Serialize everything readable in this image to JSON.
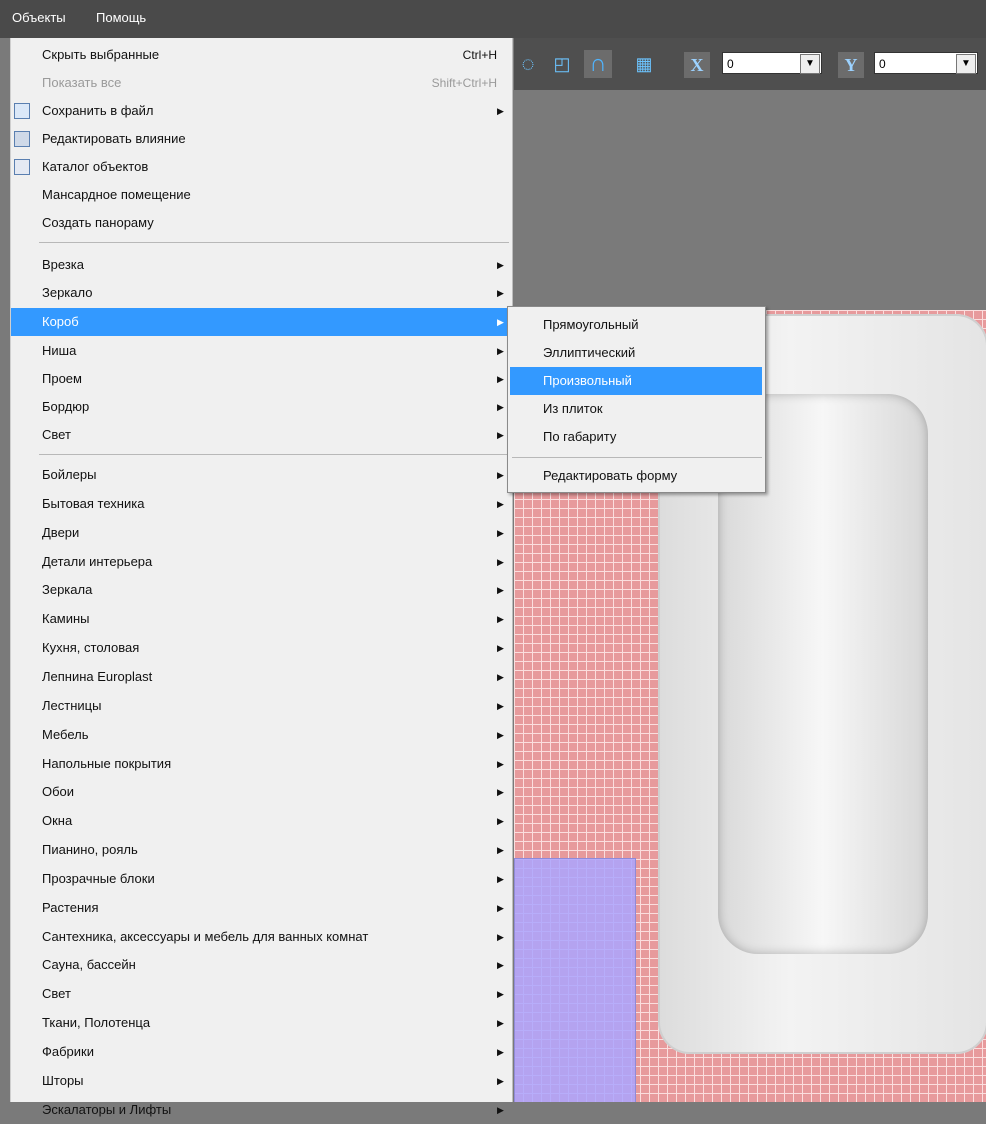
{
  "menubar": {
    "items": [
      "Объекты",
      "Помощь"
    ]
  },
  "toolbar": {
    "x_label": "X",
    "x_value": "0",
    "y_label": "Y",
    "y_value": "0"
  },
  "menu": {
    "top_items": [
      {
        "label": "Скрыть выбранные",
        "shortcut": "Ctrl+H"
      },
      {
        "label": "Показать все",
        "shortcut": "Shift+Ctrl+H",
        "disabled": true
      },
      {
        "label": "Сохранить в файл",
        "submenu": true,
        "icon": "floppy-disk-icon"
      },
      {
        "label": "Редактировать влияние",
        "icon": "calculator-icon"
      },
      {
        "label": "Каталог объектов",
        "icon": "catalog-icon"
      },
      {
        "label": "Мансардное помещение"
      },
      {
        "label": "Создать панораму"
      }
    ],
    "construct_items": [
      "Врезка",
      "Зеркало",
      "Короб",
      "Ниша",
      "Проем",
      "Бордюр",
      "Свет"
    ],
    "catalog_items": [
      "Бойлеры",
      "Бытовая техника",
      "Двери",
      "Детали интерьера",
      "Зеркала",
      "Камины",
      "Кухня, столовая",
      "Лепнина Europlast",
      "Лестницы",
      "Мебель",
      "Напольные покрытия",
      "Обои",
      "Окна",
      "Пианино, рояль",
      "Прозрачные блоки",
      "Растения",
      "Сантехника, аксессуары и мебель для ванных комнат",
      "Сауна, бассейн",
      "Свет",
      "Ткани, Полотенца",
      "Фабрики",
      "Шторы",
      "Эскалаторы и Лифты"
    ]
  },
  "submenu": {
    "items": [
      "Прямоугольный",
      "Эллиптический",
      "Произвольный",
      "Из плиток",
      "По габариту"
    ],
    "edit_item": "Редактировать форму"
  },
  "colors": {
    "highlight": "#3399ff",
    "menu_bg": "#f0f0f0",
    "menubar_bg": "#4a4a4a"
  }
}
